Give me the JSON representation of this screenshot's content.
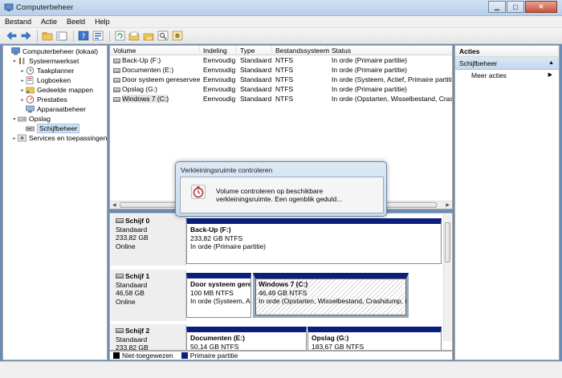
{
  "window": {
    "title": "Computerbeheer"
  },
  "menu": [
    "Bestand",
    "Actie",
    "Beeld",
    "Help"
  ],
  "tree": [
    {
      "label": "Computerbeheer (lokaal)",
      "icon": "computer-icon",
      "level": 0,
      "expander": ""
    },
    {
      "label": "Systeemwerkset",
      "icon": "tools-icon",
      "level": 1,
      "expander": "▾"
    },
    {
      "label": "Taakplanner",
      "icon": "clock-icon",
      "level": 2,
      "expander": "▸"
    },
    {
      "label": "Logboeken",
      "icon": "log-icon",
      "level": 2,
      "expander": "▸"
    },
    {
      "label": "Gedeelde mappen",
      "icon": "shared-folder-icon",
      "level": 2,
      "expander": "▸"
    },
    {
      "label": "Prestaties",
      "icon": "performance-icon",
      "level": 2,
      "expander": "▸"
    },
    {
      "label": "Apparaatbeheer",
      "icon": "device-manager-icon",
      "level": 2,
      "expander": ""
    },
    {
      "label": "Opslag",
      "icon": "storage-icon",
      "level": 1,
      "expander": "▾"
    },
    {
      "label": "Schijfbeheer",
      "icon": "disk-management-icon",
      "level": 2,
      "expander": "",
      "selected": true
    },
    {
      "label": "Services en toepassingen",
      "icon": "services-icon",
      "level": 1,
      "expander": "▸"
    }
  ],
  "volumes": {
    "headers": [
      "Volume",
      "Indeling",
      "Type",
      "Bestandssysteem",
      "Status"
    ],
    "rows": [
      [
        "Back-Up (F:)",
        "Eenvoudig",
        "Standaard",
        "NTFS",
        "In orde (Primaire partitie)"
      ],
      [
        "Documenten (E:)",
        "Eenvoudig",
        "Standaard",
        "NTFS",
        "In orde (Primaire partitie)"
      ],
      [
        "Door systeem gereserveerd",
        "Eenvoudig",
        "Standaard",
        "NTFS",
        "In orde (Systeem, Actief, Primaire partitie)"
      ],
      [
        "Opslag (G:)",
        "Eenvoudig",
        "Standaard",
        "NTFS",
        "In orde (Primaire partitie)"
      ],
      [
        "Windows 7 (C:)",
        "Eenvoudig",
        "Standaard",
        "NTFS",
        "In orde (Opstarten, Wisselbestand, Crashdump, Primaire partitie)"
      ]
    ]
  },
  "disks": [
    {
      "name": "Schijf 0",
      "type": "Standaard",
      "size": "233,82 GB",
      "state": "Online",
      "partitions": [
        {
          "name": "Back-Up  (F:)",
          "size": "233,82 GB NTFS",
          "status": "In orde (Primaire partitie)"
        }
      ]
    },
    {
      "name": "Schijf 1",
      "type": "Standaard",
      "size": "46,58 GB",
      "state": "Online",
      "partitions": [
        {
          "name": "Door systeem gere",
          "size": "100 MB NTFS",
          "status": "In orde (Systeem, Ac"
        },
        {
          "name": "Windows 7  (C:)",
          "size": "46,49 GB NTFS",
          "status": "In orde (Opstarten, Wisselbestand, Crashdump, Prin"
        }
      ]
    },
    {
      "name": "Schijf 2",
      "type": "Standaard",
      "size": "233,82 GB",
      "state": "",
      "partitions": [
        {
          "name": "Documenten  (E:)",
          "size": "50,14 GB NTFS",
          "status": ""
        },
        {
          "name": "Opslag  (G:)",
          "size": "183,67 GB NTFS",
          "status": ""
        }
      ]
    }
  ],
  "legend": [
    {
      "label": "Niet-toegewezen",
      "color": "#000000"
    },
    {
      "label": "Primaire partitie",
      "color": "#0a1f7d"
    }
  ],
  "actions": {
    "title": "Acties",
    "group": "Schijfbeheer",
    "item": "Meer acties"
  },
  "dialog": {
    "title": "Verkleiningsruimte controleren",
    "message": "Volume controleren op beschikbare verkleiningsruimte. Een ogenblik geduld..."
  }
}
